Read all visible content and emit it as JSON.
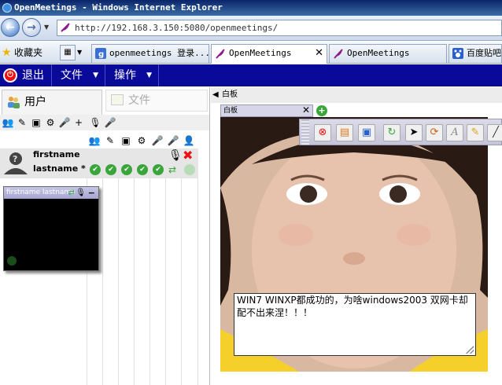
{
  "browser": {
    "title": "OpenMeetings - Windows Internet Explorer",
    "address": "http://192.168.3.150:5080/openmeetings/",
    "favorites_label": "收藏夹",
    "tabs": [
      {
        "label": "openmeetings 登录...",
        "active": false
      },
      {
        "label": "OpenMeetings",
        "active": true
      },
      {
        "label": "OpenMeetings",
        "active": false
      },
      {
        "label": "百度贴吧",
        "active": false
      }
    ]
  },
  "app_menu": {
    "exit_label": "退出",
    "file_label": "文件",
    "actions_label": "操作"
  },
  "left_panel": {
    "users_tab": "用户",
    "files_tab": "文件",
    "user": {
      "firstname": "firstname",
      "lastname": "lastname *"
    },
    "video_title": "firstname lastname"
  },
  "whiteboard": {
    "header": "白板",
    "tab_label": "白板",
    "text_content": "WIN7 WINXP都成功的，为啥windows2003 双网卡却配不出来涅！！！"
  },
  "colors": {
    "menu_bg": "#0a0a9a",
    "accept_green": "#3aa53a",
    "close_red": "#e11"
  }
}
